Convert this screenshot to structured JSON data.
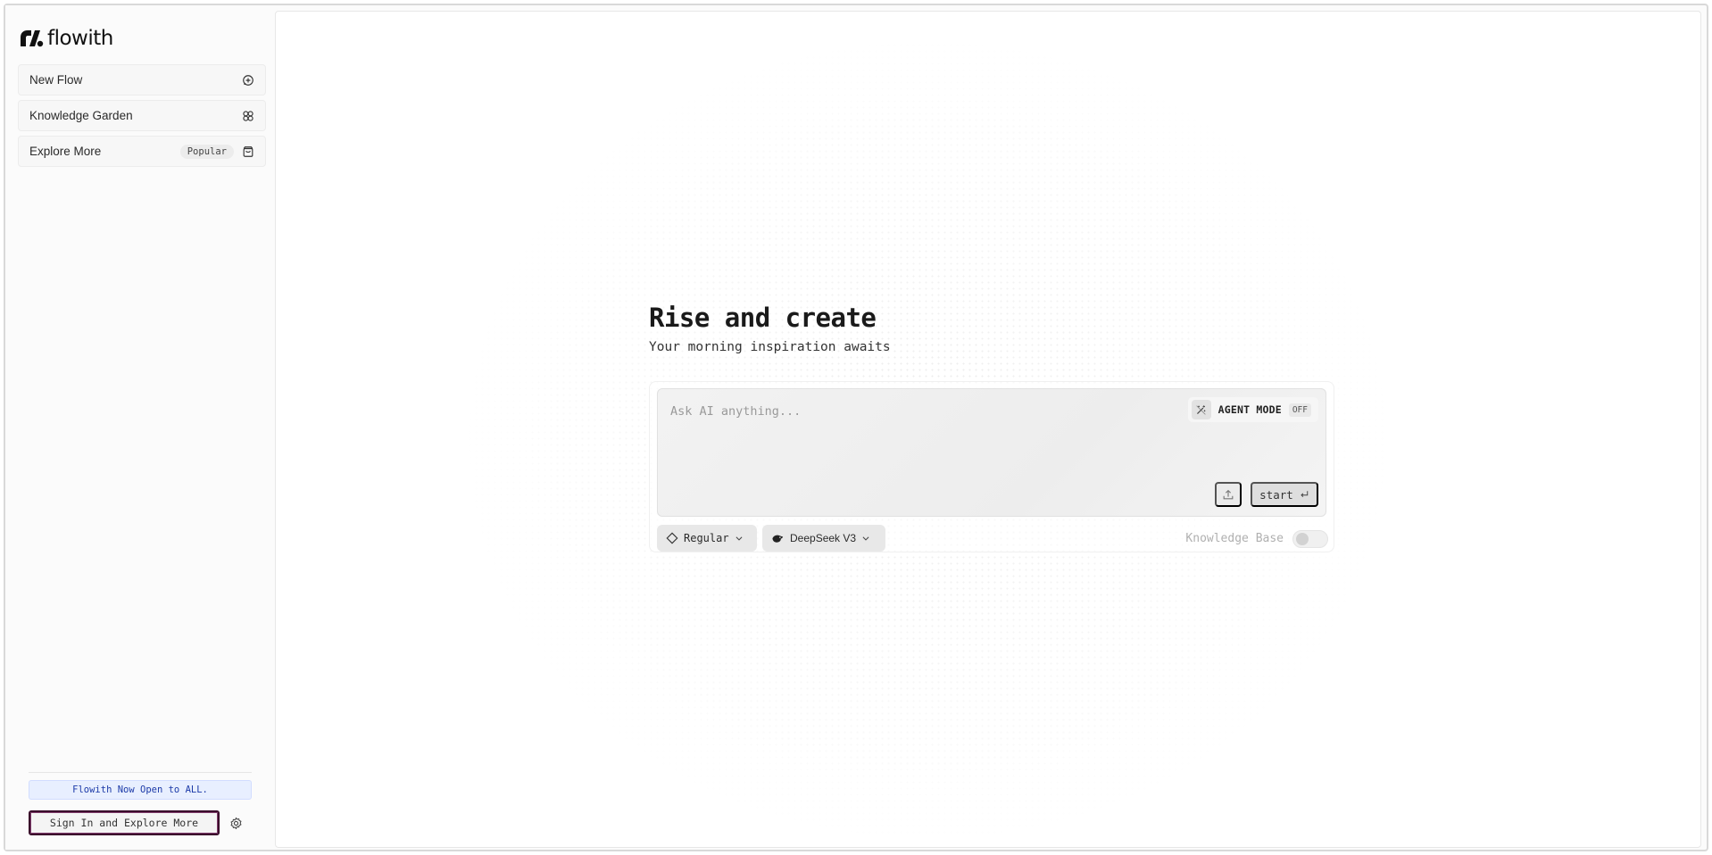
{
  "brand": {
    "name": "flowith"
  },
  "sidebar": {
    "items": [
      {
        "label": "New Flow",
        "icon": "chat-plus-icon"
      },
      {
        "label": "Knowledge Garden",
        "icon": "garden-icon"
      },
      {
        "label": "Explore More",
        "badge": "Popular",
        "icon": "bag-icon"
      }
    ],
    "announcement": "Flowith Now Open to ALL.",
    "signin_label": "Sign In and Explore More"
  },
  "hero": {
    "title": "Rise and create",
    "subtitle": "Your morning inspiration awaits"
  },
  "composer": {
    "placeholder": "Ask AI anything...",
    "agent_mode_label": "AGENT MODE",
    "agent_mode_state": "OFF",
    "start_label": "start",
    "mode_label": "Regular",
    "model_label": "DeepSeek V3",
    "knowledge_base_label": "Knowledge Base",
    "knowledge_base_enabled": false
  },
  "colors": {
    "accent_announce_bg": "#e8efff",
    "accent_announce_text": "#1c3aa8",
    "signin_border": "#3a0d2b"
  }
}
